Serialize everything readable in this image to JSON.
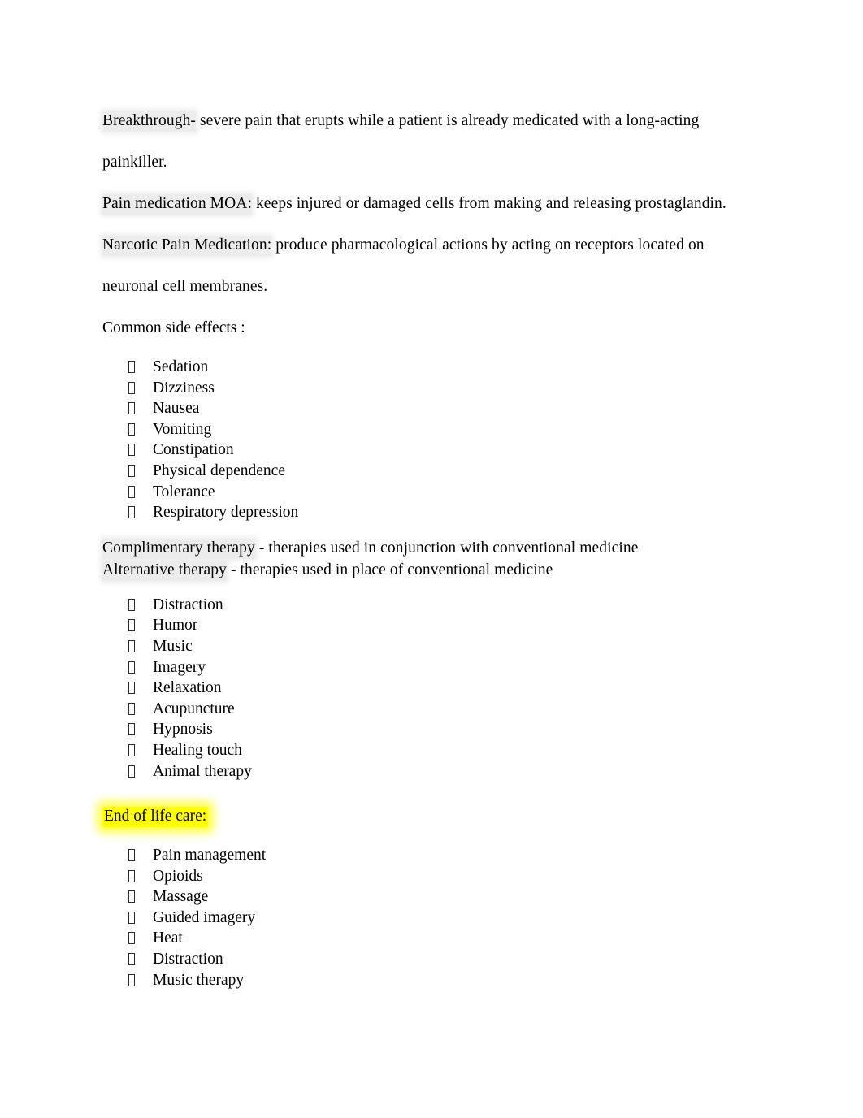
{
  "document": {
    "page_background": "#ffffff",
    "text_color": "#000000",
    "shade_color": "#ececec",
    "highlight_color": "#ffff00",
    "bullet_glyph": "missing-glyph-box"
  },
  "paragraphs": {
    "breakthrough": {
      "term": "Breakthrough-",
      "definition": " severe pain that erupts while a patient is already medicated with a long-acting painkiller."
    },
    "moa": {
      "term": "Pain medication MOA:",
      "definition": " keeps injured or damaged cells from making and releasing prostaglandin."
    },
    "narcotic": {
      "term": "Narcotic Pain Medication:",
      "definition": " produce pharmacological actions by acting on receptors located on neuronal cell membranes."
    },
    "common_side_effects_heading": "Common side effects :",
    "complimentary": {
      "term": "Complimentary therapy",
      "definition": " - therapies used in conjunction with conventional medicine"
    },
    "alternative": {
      "term": "Alternative therapy",
      "definition": " - therapies used in place of conventional medicine"
    },
    "end_of_life_heading": "End of life care:"
  },
  "lists": {
    "side_effects": [
      "Sedation",
      "Dizziness",
      "Nausea",
      "Vomiting",
      "Constipation",
      "Physical dependence",
      "Tolerance",
      "Respiratory depression"
    ],
    "therapies": [
      "Distraction",
      "Humor",
      "Music",
      "Imagery",
      "Relaxation",
      "Acupuncture",
      "Hypnosis",
      "Healing touch",
      "Animal therapy"
    ],
    "end_of_life_care": [
      "Pain management",
      "Opioids",
      "Massage",
      "Guided imagery",
      "Heat",
      "Distraction",
      "Music therapy"
    ]
  }
}
